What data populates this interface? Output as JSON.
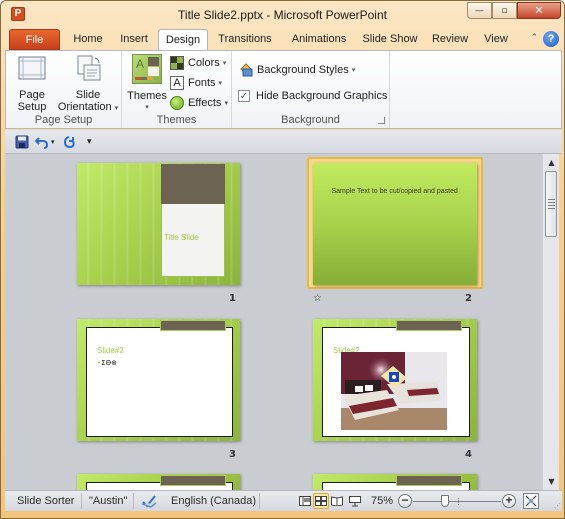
{
  "window": {
    "title": "Title Slide2.pptx  -  Microsoft PowerPoint",
    "app_icon_letter": "P",
    "controls": {
      "minimize": "—",
      "restore": "▫",
      "close": "✕"
    }
  },
  "tabs": [
    {
      "label": "File",
      "active": false
    },
    {
      "label": "Home",
      "active": false
    },
    {
      "label": "Insert",
      "active": false
    },
    {
      "label": "Design",
      "active": true
    },
    {
      "label": "Transitions",
      "active": false
    },
    {
      "label": "Animations",
      "active": false
    },
    {
      "label": "Slide Show",
      "active": false
    },
    {
      "label": "Review",
      "active": false
    },
    {
      "label": "View",
      "active": false
    }
  ],
  "tabbar": {
    "collapse_glyph": "⌃",
    "help_glyph": "?"
  },
  "ribbon": {
    "page_setup": {
      "label": "Page Setup",
      "page_setup_btn_line1": "Page",
      "page_setup_btn_line2": "Setup",
      "slide_orientation_line1": "Slide",
      "slide_orientation_line2": "Orientation"
    },
    "themes": {
      "label": "Themes",
      "themes_btn": "Themes",
      "colors": "Colors",
      "fonts": "Fonts",
      "effects": "Effects"
    },
    "background": {
      "label": "Background",
      "background_styles": "Background Styles",
      "hide_background_graphics": "Hide Background Graphics",
      "hide_background_graphics_checked": true
    },
    "caret": "▾"
  },
  "qat": {
    "save": "save-icon",
    "undo": "undo-icon",
    "redo": "redo-icon",
    "customize": "customize-icon"
  },
  "slides": [
    {
      "number": "1",
      "title": "Title Slide",
      "layout": "title",
      "selected": false
    },
    {
      "number": "2",
      "body": "Sample Text to be cut/copied and pasted",
      "layout": "content-green",
      "selected": true,
      "has_animation": true
    },
    {
      "number": "3",
      "title": "Slide#2",
      "bullet": "ΣΘ⊕",
      "layout": "content",
      "selected": false
    },
    {
      "number": "4",
      "title": "Slide#2",
      "layout": "picture",
      "selected": false
    }
  ],
  "statusbar": {
    "view_name": "Slide Sorter",
    "theme_name": "\"Austin\"",
    "language": "English (Canada)",
    "zoom": "75%",
    "zoom_level_percent": 75,
    "zoom_minus": "−",
    "zoom_plus": "+"
  },
  "scrollbar": {
    "up": "▲",
    "down": "▼"
  }
}
